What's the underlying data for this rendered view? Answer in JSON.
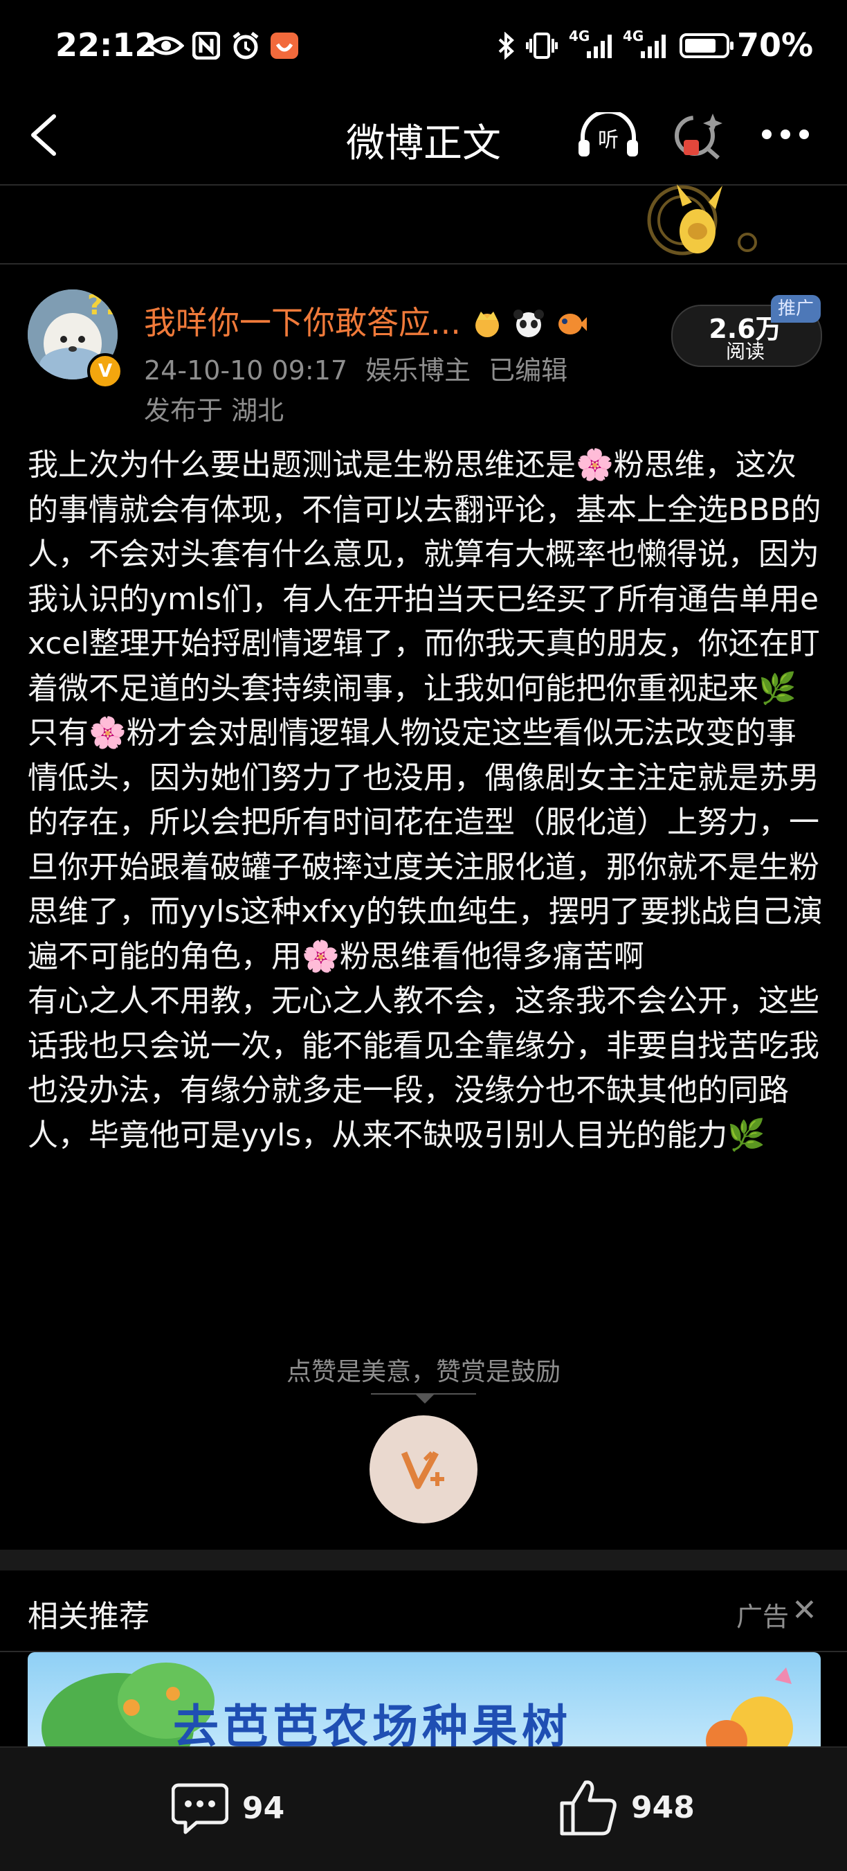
{
  "status_bar": {
    "time": "22:12",
    "network_1": "4G",
    "network_2": "4G",
    "battery": "70%"
  },
  "nav": {
    "title": "微博正文"
  },
  "author": {
    "name": "我咩你一下你敢答应...",
    "date": "24-10-10 09:17",
    "role": "娱乐博主",
    "edited": "已编辑",
    "location": "发布于 湖北",
    "read_count": "2.6万",
    "read_label": "阅读",
    "promo_tag": "推广"
  },
  "post": {
    "paragraphs": [
      "我上次为什么要出题测试是生粉思维还是🌸粉思维，这次的事情就会有体现，不信可以去翻评论，基本上全选BBB的人，不会对头套有什么意见，就算有大概率也懒得说，因为我认识的ymls们，有人在开拍当天已经买了所有通告单用excel整理开始捋剧情逻辑了，而你我天真的朋友，你还在盯着微不足道的头套持续闹事，让我如何能把你重视起来🌿",
      "只有🌸粉才会对剧情逻辑人物设定这些看似无法改变的事情低头，因为她们努力了也没用，偶像剧女主注定就是苏男的存在，所以会把所有时间花在造型（服化道）上努力，一旦你开始跟着破罐子破摔过度关注服化道，那你就不是生粉思维了，而yyls这种xfxy的铁血纯生，摆明了要挑战自己演遍不可能的角色，用🌸粉思维看他得多痛苦啊",
      "有心之人不用教，无心之人教不会，这条我不会公开，这些话我也只会说一次，能不能看见全靠缘分，非要自找苦吃我也没办法，有缘分就多走一段，没缘分也不缺其他的同路人，毕竟他可是yyls，从来不缺吸引别人目光的能力🌿"
    ]
  },
  "reward": {
    "hint": "点赞是美意，赞赏是鼓励"
  },
  "related": {
    "title": "相关推荐",
    "ad_label": "广告",
    "ad_text": "去芭芭农场种果树"
  },
  "bottom_bar": {
    "comments": "94",
    "likes": "948"
  },
  "colors": {
    "accent_name": "#f07a3a",
    "vip_badge": "#f3a60e",
    "promo_tag": "#4d78b8",
    "ad_text": "#1f4fb3"
  },
  "icons": [
    "eye-icon",
    "nfc-icon",
    "alarm-icon",
    "shopping-app-icon",
    "bluetooth-icon",
    "vibrate-icon",
    "signal-icon",
    "battery-icon",
    "back-icon",
    "listen-icon",
    "ai-assistant-icon",
    "more-icon",
    "comment-icon",
    "like-icon",
    "reward-icon",
    "close-icon"
  ]
}
